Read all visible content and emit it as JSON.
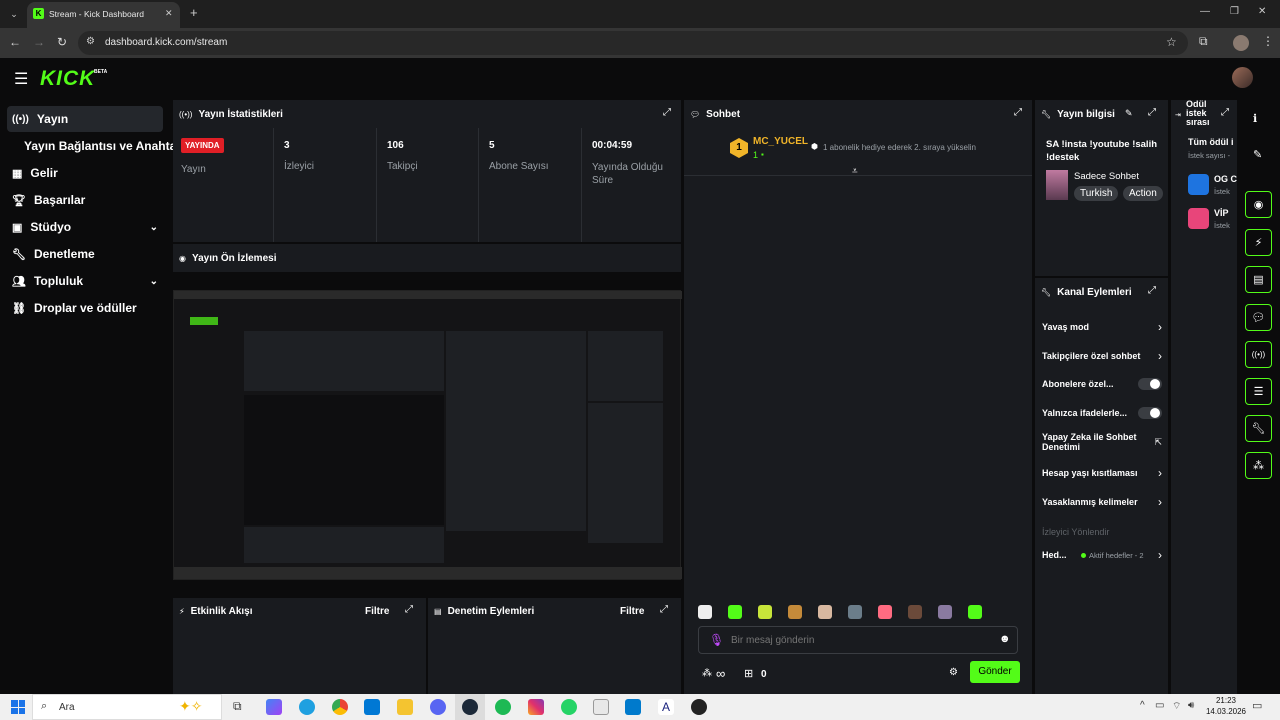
{
  "browser": {
    "tab_title": "Stream - Kick Dashboard",
    "url": "dashboard.kick.com/stream",
    "new_tab_glyph": "+",
    "close_glyph": "✕"
  },
  "header": {
    "logo": "KICK",
    "logo_badge": "BETA"
  },
  "sidebar": {
    "items": [
      {
        "label": "Yayın",
        "icon": "broadcast-icon"
      },
      {
        "label": "Yayın Bağlantısı ve Anahtarı"
      },
      {
        "label": "Gelir",
        "icon": "chart-icon"
      },
      {
        "label": "Başarılar",
        "icon": "trophy-icon"
      },
      {
        "label": "Stüdyo",
        "icon": "studio-icon"
      },
      {
        "label": "Denetleme",
        "icon": "wrench-icon"
      },
      {
        "label": "Topluluk",
        "icon": "community-icon"
      },
      {
        "label": "Droplar ve ödüller",
        "icon": "drops-icon"
      }
    ]
  },
  "stats": {
    "title": "Yayın İstatistikleri",
    "live_badge": "YAYINDA",
    "live_label": "Yayın",
    "viewers_value": "3",
    "viewers_label": "İzleyici",
    "followers_value": "106",
    "followers_label": "Takipçi",
    "subs_value": "5",
    "subs_label": "Abone Sayısı",
    "uptime_value": "00:04:59",
    "uptime_label": "Yayında Olduğu Süre"
  },
  "preview": {
    "title": "Yayın Ön İzlemesi"
  },
  "activity": {
    "title": "Etkinlik Akışı",
    "filter": "Filtre"
  },
  "moderation_actions": {
    "title": "Denetim Eylemleri",
    "filter": "Filtre"
  },
  "chat": {
    "title": "Sohbet",
    "pinned_user": "MC_YUCEL",
    "pinned_rank": "1",
    "pinned_count": "1",
    "pinned_message": "1 abonelik hediye ederek 2. sıraya yükselin",
    "input_placeholder": "Bir mesaj gönderin",
    "infinity": "∞",
    "gift_count": "0",
    "send_label": "Gönder"
  },
  "stream_info": {
    "title": "Yayın bilgisi",
    "stream_title": "SA !insta !youtube !salih !destek",
    "category": "Sadece Sohbet",
    "tags": [
      "Turkish",
      "Action"
    ]
  },
  "channel_actions": {
    "title": "Kanal Eylemleri",
    "items": [
      {
        "label": "Yavaş mod",
        "control": "chevron"
      },
      {
        "label": "Takipçilere özel sohbet",
        "control": "chevron"
      },
      {
        "label": "Abonelere özel...",
        "control": "toggle"
      },
      {
        "label": "Yalnızca ifadelerle...",
        "control": "toggle"
      },
      {
        "label": "Yapay Zeka ile Sohbet Denetimi",
        "control": "external"
      },
      {
        "label": "Hesap yaşı kısıtlaması",
        "control": "chevron"
      },
      {
        "label": "Yasaklanmış kelimeler",
        "control": "chevron"
      },
      {
        "label": "İzleyici Yönlendir",
        "control": "none"
      },
      {
        "label": "Hed...",
        "control": "chevron"
      }
    ],
    "goals_status": "Aktif hedefler - 2"
  },
  "rewards": {
    "title": "Ödül istek sırası",
    "subtitle": "Tüm ödül i",
    "sub2": "İstek sayısı -",
    "items": [
      {
        "name": "OG C",
        "sub": "İstek"
      },
      {
        "name": "VİP",
        "sub": "İstek"
      }
    ]
  },
  "taskbar": {
    "search_placeholder": "Ara",
    "time": "21:23",
    "date": "14.03.2026"
  },
  "colors": {
    "brand": "#53fc18",
    "live": "#e01f26",
    "panel": "#191b1f"
  }
}
